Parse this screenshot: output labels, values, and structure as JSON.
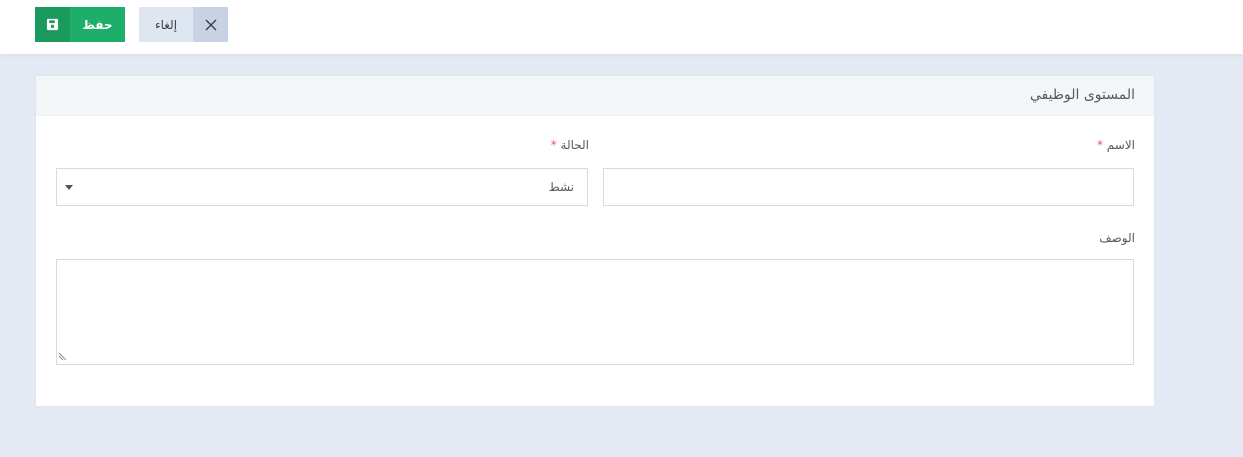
{
  "toolbar": {
    "save_label": "حفظ",
    "save_icon": "floppy-disk-icon",
    "cancel_label": "إلغاء",
    "cancel_icon": "close-icon"
  },
  "panel": {
    "title": "المستوى الوظيفي"
  },
  "form": {
    "name": {
      "label": "الاسم",
      "required_mark": "*",
      "value": ""
    },
    "status": {
      "label": "الحالة",
      "required_mark": "*",
      "value": "نشط"
    },
    "description": {
      "label": "الوصف",
      "value": ""
    }
  },
  "colors": {
    "save_button": "#1fae6a",
    "cancel_button": "#dde6f1",
    "page_background": "#e4eaf3",
    "required_mark": "#f4516c"
  }
}
